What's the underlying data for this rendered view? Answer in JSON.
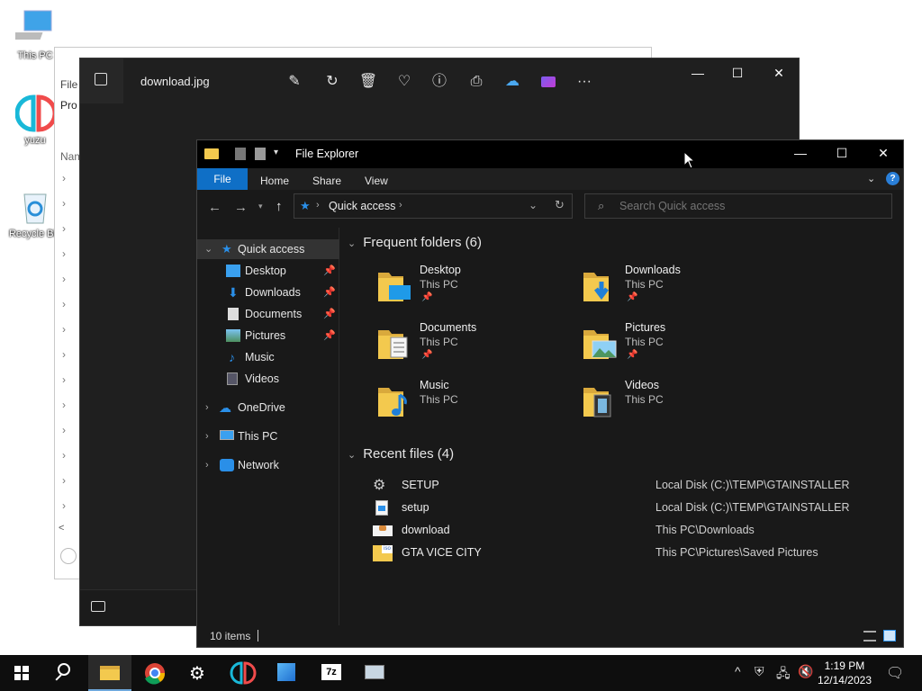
{
  "desktop": {
    "icons": [
      {
        "label": "This PC"
      },
      {
        "label": "yuzu"
      },
      {
        "label": "Recycle Bin"
      }
    ]
  },
  "bg_window": {
    "menu_label": "File",
    "second_label": "Pro",
    "column_label": "Nam"
  },
  "photos": {
    "filename": "download.jpg",
    "tools": [
      "edit-icon",
      "rotate-icon",
      "delete-icon",
      "favorite-icon",
      "info-icon",
      "print-icon",
      "onedrive-icon",
      "clipchamp-icon",
      "more-icon"
    ]
  },
  "explorer": {
    "title": "File Explorer",
    "tabs": [
      "File",
      "Home",
      "Share",
      "View"
    ],
    "address": {
      "location": "Quick access"
    },
    "search": {
      "placeholder": "Search Quick access"
    },
    "nav": {
      "quick_access": "Quick access",
      "items": [
        {
          "label": "Desktop",
          "pinned": true
        },
        {
          "label": "Downloads",
          "pinned": true
        },
        {
          "label": "Documents",
          "pinned": true
        },
        {
          "label": "Pictures",
          "pinned": true
        },
        {
          "label": "Music",
          "pinned": false
        },
        {
          "label": "Videos",
          "pinned": false
        }
      ],
      "onedrive": "OneDrive",
      "this_pc": "This PC",
      "network": "Network"
    },
    "frequent": {
      "header": "Frequent folders (6)",
      "folders": [
        {
          "name": "Desktop",
          "location": "This PC",
          "pinned": true
        },
        {
          "name": "Downloads",
          "location": "This PC",
          "pinned": true
        },
        {
          "name": "Documents",
          "location": "This PC",
          "pinned": true
        },
        {
          "name": "Pictures",
          "location": "This PC",
          "pinned": true
        },
        {
          "name": "Music",
          "location": "This PC",
          "pinned": false
        },
        {
          "name": "Videos",
          "location": "This PC",
          "pinned": false
        }
      ]
    },
    "recent": {
      "header": "Recent files (4)",
      "files": [
        {
          "name": "SETUP",
          "path": "Local Disk (C:)\\TEMP\\GTAINSTALLER"
        },
        {
          "name": "setup",
          "path": "Local Disk (C:)\\TEMP\\GTAINSTALLER"
        },
        {
          "name": "download",
          "path": "This PC\\Downloads"
        },
        {
          "name": "GTA VICE CITY",
          "path": "This PC\\Pictures\\Saved Pictures"
        }
      ]
    },
    "status": {
      "count": "10 items"
    }
  },
  "taskbar": {
    "clock_time": "1:19 PM",
    "clock_date": "12/14/2023",
    "apps": [
      "file-explorer-icon",
      "chrome-icon",
      "settings-icon",
      "yuzu-icon",
      "photos-icon",
      "7zip-icon",
      "remote-icon"
    ]
  },
  "colors": {
    "accent": "#0f6fc6",
    "folder": "#f3c94e",
    "dark_bg": "#191919"
  }
}
